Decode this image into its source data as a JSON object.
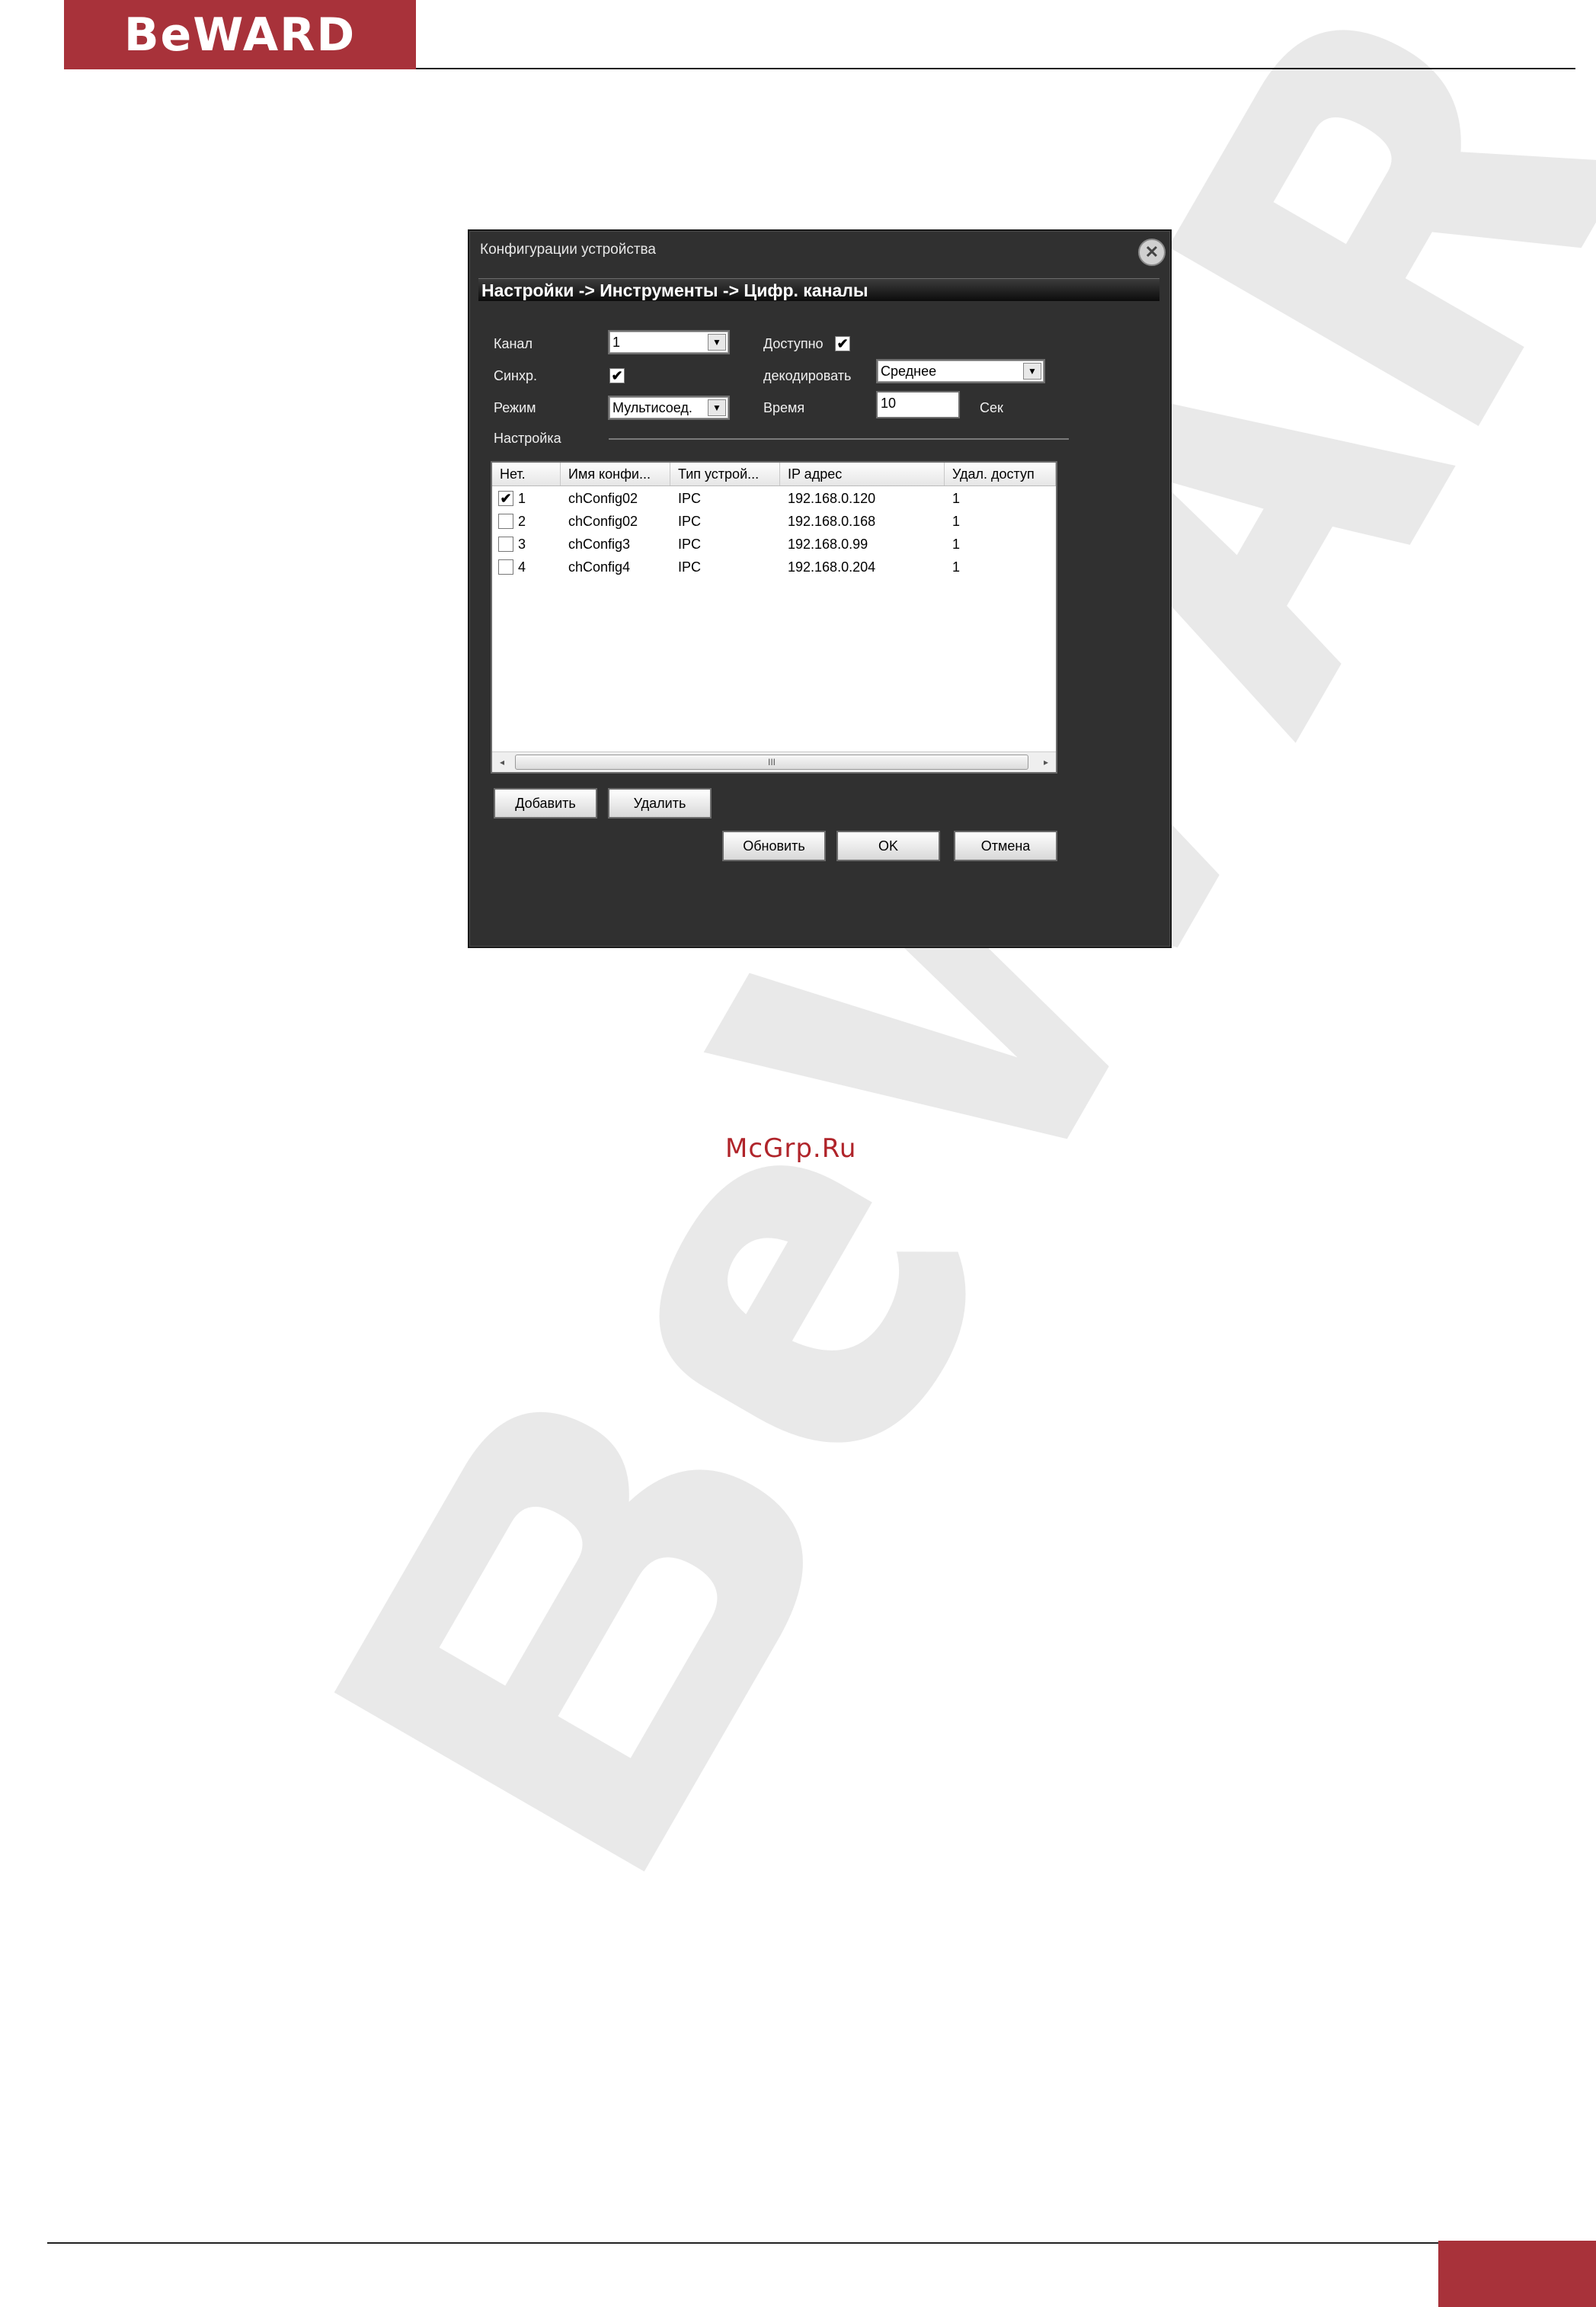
{
  "brand": {
    "logo_text": "BeWARD",
    "accent_color": "#a8323a"
  },
  "watermark_text": "McGrp.Ru",
  "dialog": {
    "title": "Конфигурации устройства",
    "close_icon": "close-icon",
    "breadcrumb": "Настройки -> Инструменты -> Цифр. каналы",
    "channel_label": "Канал",
    "channel_value": "1",
    "available_label": "Доступно",
    "available_checked": "✔",
    "sync_label": "Синхр.",
    "sync_checked": "✔",
    "decode_label": "декодировать",
    "decode_value": "Среднее",
    "mode_label": "Режим",
    "mode_value": "Мультисоед.",
    "time_label": "Время",
    "time_value": "10",
    "time_unit": "Сек",
    "settings_label": "Настройка",
    "table": {
      "columns": [
        "Нет.",
        "Имя конфи...",
        "Тип устрой...",
        "IP адрес",
        "Удал. доступ"
      ],
      "rows": [
        {
          "checked": "✔",
          "num": "1",
          "name": "chConfig02",
          "type": "IPC",
          "ip": "192.168.0.120",
          "remote": "1"
        },
        {
          "checked": "",
          "num": "2",
          "name": "chConfig02",
          "type": "IPC",
          "ip": "192.168.0.168",
          "remote": "1"
        },
        {
          "checked": "",
          "num": "3",
          "name": "chConfig3",
          "type": "IPC",
          "ip": "192.168.0.99",
          "remote": "1"
        },
        {
          "checked": "",
          "num": "4",
          "name": "chConfig4",
          "type": "IPC",
          "ip": "192.168.0.204",
          "remote": "1"
        }
      ],
      "scroll_left": "◂",
      "scroll_thumb": "III",
      "scroll_right": "▸"
    },
    "buttons": {
      "add": "Добавить",
      "delete": "Удалить",
      "refresh": "Обновить",
      "ok": "OK",
      "cancel": "Отмена"
    }
  }
}
